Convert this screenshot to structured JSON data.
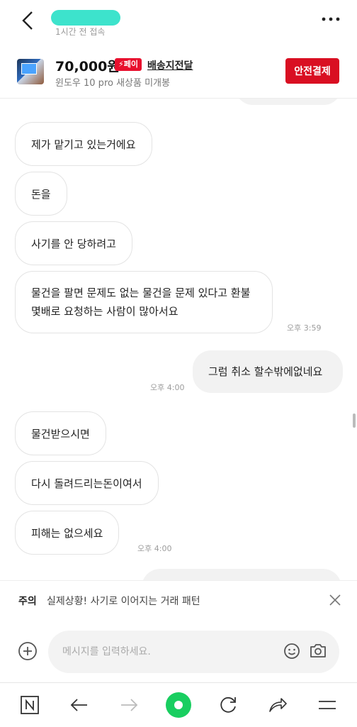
{
  "header": {
    "last_seen": "1시간 전 접속",
    "back_icon": "chevron-left-icon",
    "more_icon": "more-horizontal-icon"
  },
  "product": {
    "price": "70,000원",
    "pay_badge": "⚡페이",
    "shipping": "배송지전달",
    "title": "윈도우 10 pro 새상품 미개봉",
    "safe_pay_label": "안전결제"
  },
  "messages": [
    {
      "side": "left",
      "text": "제가 맡기고 있는거에요"
    },
    {
      "side": "left",
      "text": "돈을"
    },
    {
      "side": "left",
      "text": "사기를 안 당하려고"
    },
    {
      "side": "left",
      "text": "물건을 팔면 문제도 없는 물건을 문제 있다고 환불 몇배로 요청하는 사람이 많아서요",
      "time": "오후 3:59"
    },
    {
      "side": "right",
      "text": "그럼 취소 할수밖에없네요",
      "time": "오후 4:00"
    },
    {
      "side": "left",
      "text": "물건받으시면"
    },
    {
      "side": "left",
      "text": "다시 돌려드리는돈이여서"
    },
    {
      "side": "left",
      "text": "피해는 없으세요",
      "time": "오후 4:00"
    }
  ],
  "warning": {
    "tag": "주의",
    "message": "실제상황! 사기로 이어지는 거래 패턴"
  },
  "composer": {
    "placeholder": "메시지를 입력하세요."
  },
  "browser_bar": {
    "icons": [
      "n-icon",
      "back-arrow-icon",
      "forward-arrow-icon",
      "home-dot-icon",
      "refresh-icon",
      "share-icon",
      "menu-icon"
    ]
  },
  "colors": {
    "accent_red": "#d90f22",
    "badge_red": "#e8102e",
    "naver_green": "#19ce60"
  }
}
